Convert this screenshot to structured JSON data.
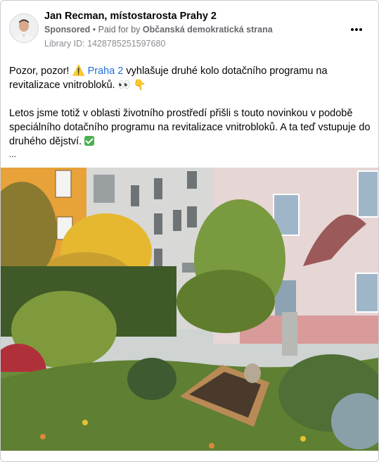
{
  "post": {
    "author": "Jan Recman, místostarosta Prahy 2",
    "sponsored": "Sponsored",
    "paid_prefix": "Paid for by",
    "paid_by": "Občanská demokratická strana",
    "library_id": "Library ID: 1428785251597680",
    "more_icon": "more-horizontal-icon",
    "text": {
      "p1_start": "Pozor, pozor! ",
      "p1_warning_emoji": "⚠️",
      "p1_link": "Praha 2",
      "p1_rest": " vyhlašuje druhé kolo dotačního programu na revitalizace vnitrobloků. ",
      "p1_emojis": "👀 👇",
      "p2": "Letos jsme totiž v oblasti životního prostředí přišli s touto novinkou v podobě speciálního dotačního programu na revitalizace vnitrobloků. A ta teď vstupuje do druhého dějství. ",
      "ellipsis": "..."
    },
    "image": {
      "description_icon": "courtyard-photo",
      "colors": {
        "yellow_building": "#e8a23a",
        "white_building": "#d8d8d6",
        "pink_building": "#e6d6d6",
        "grass": "#6d8a3a",
        "soil": "#4a3a2c"
      }
    }
  }
}
